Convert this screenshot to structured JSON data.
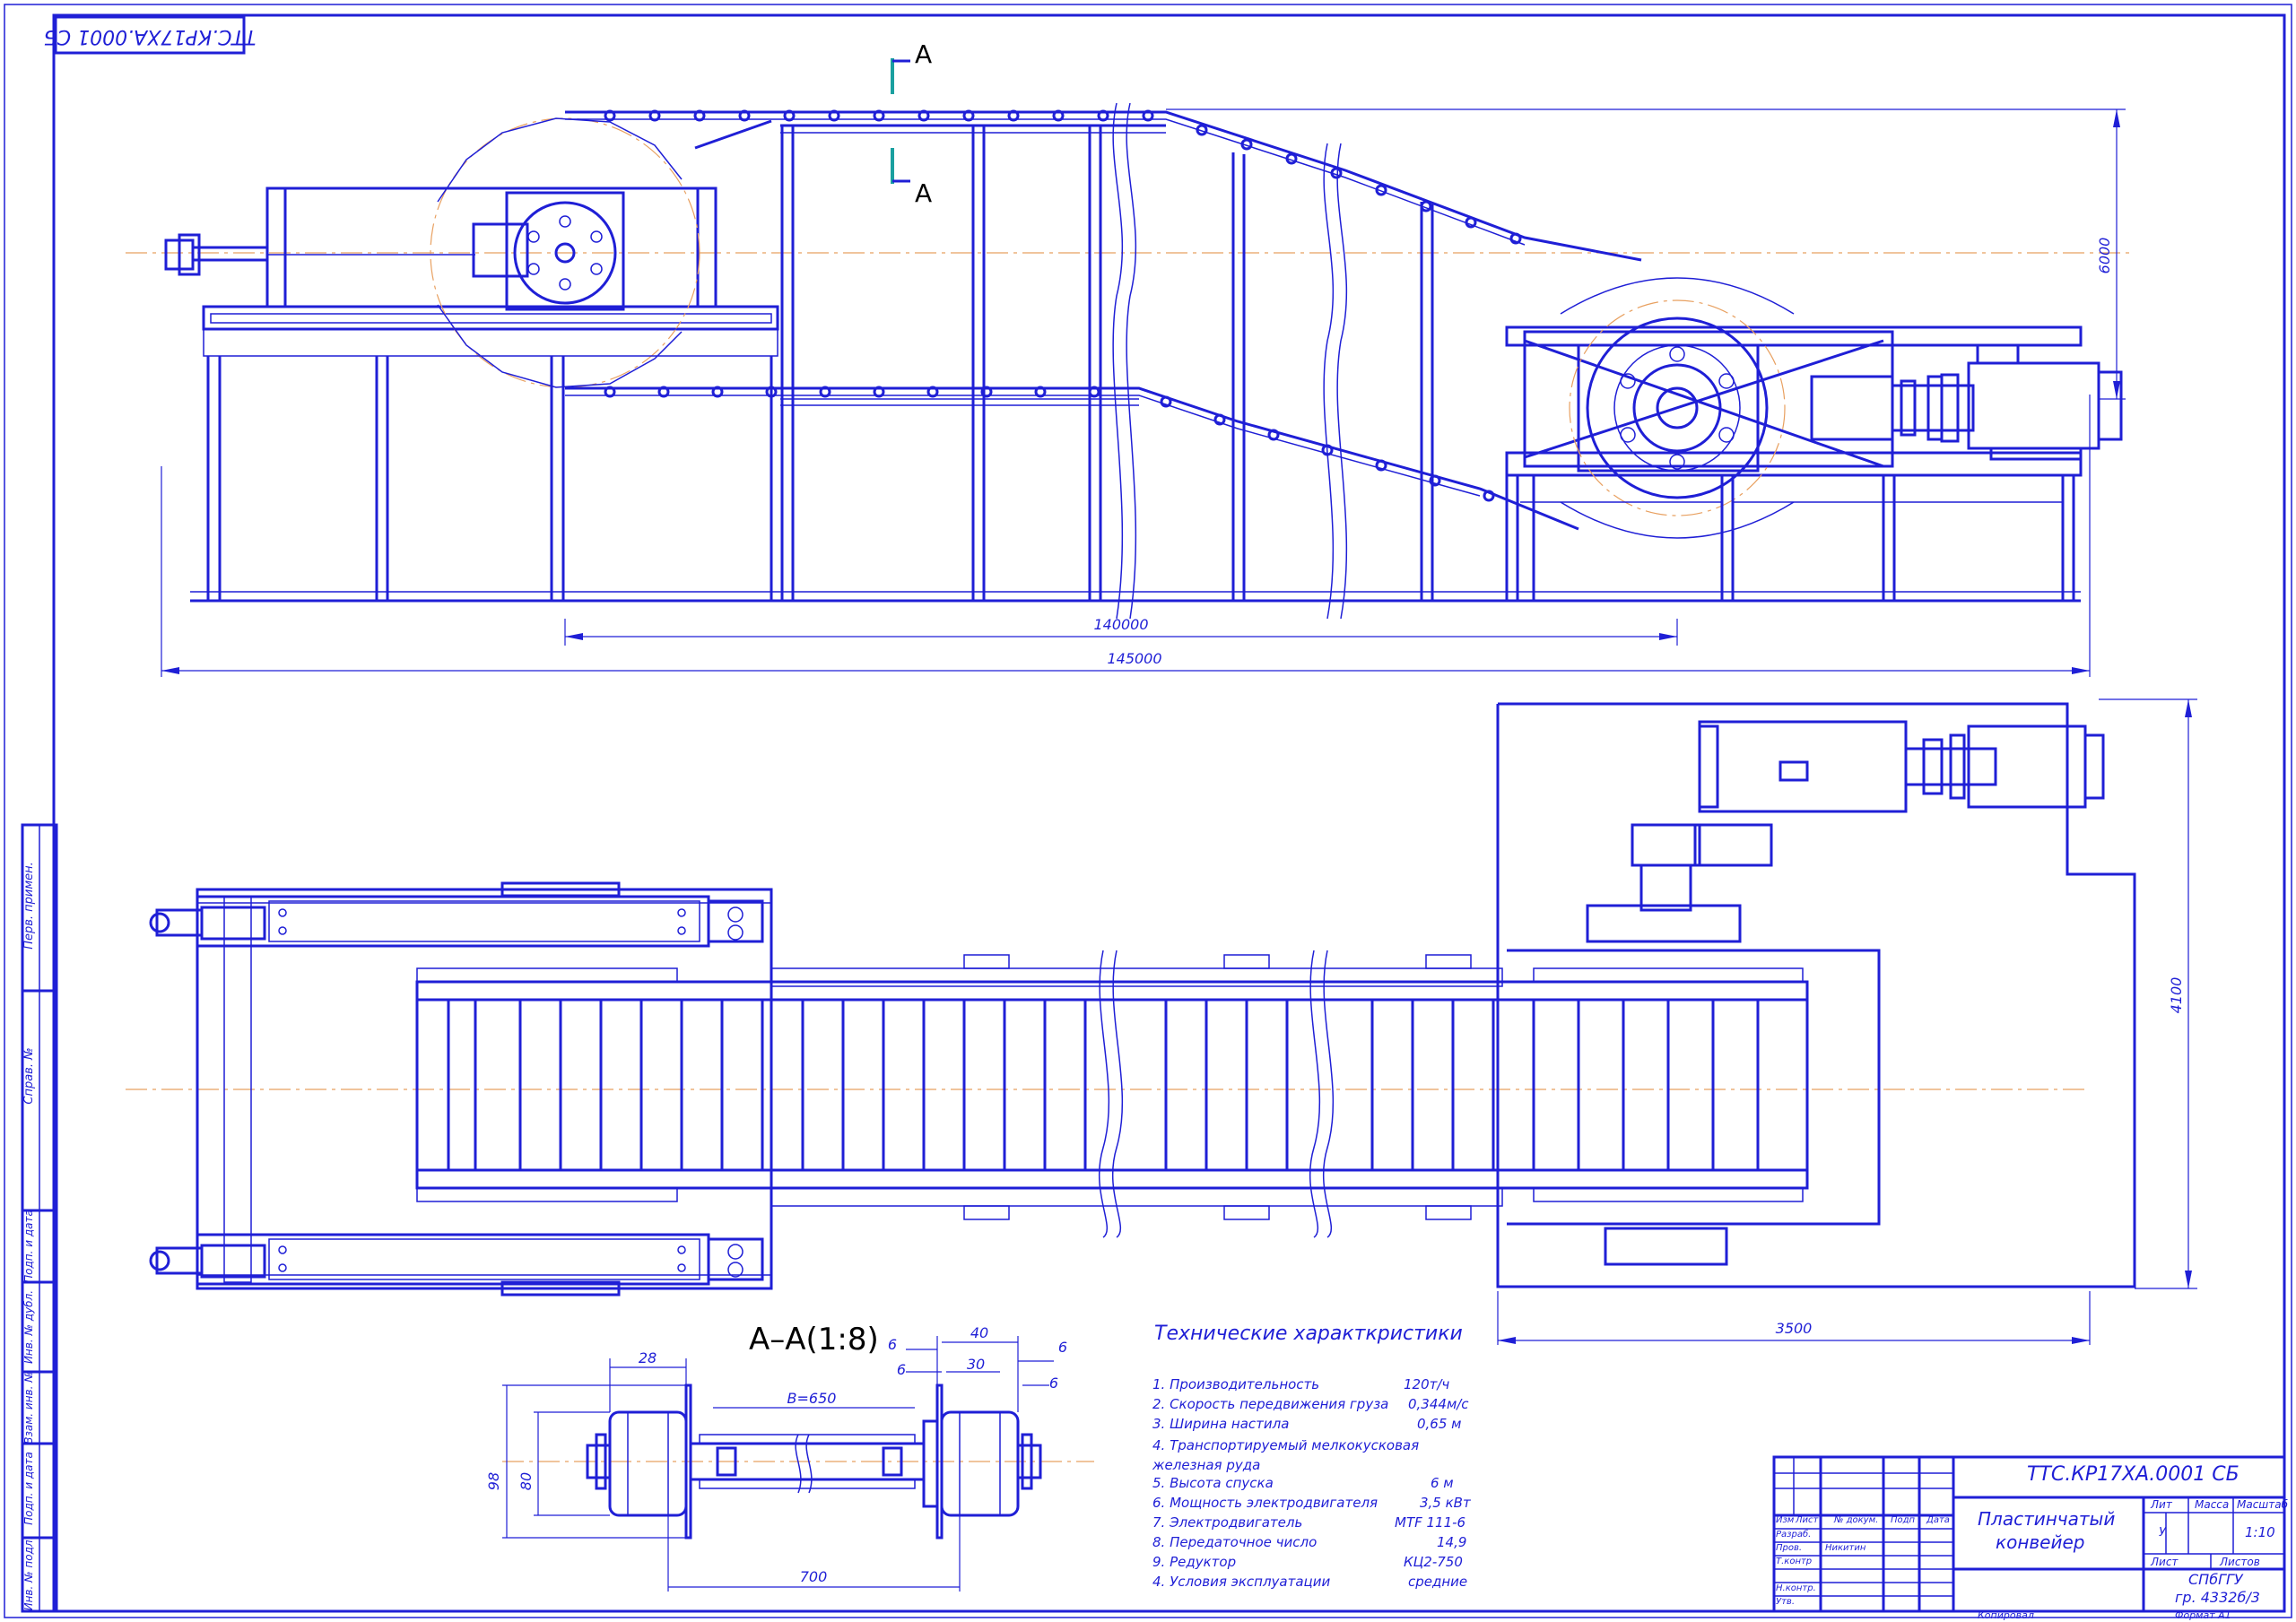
{
  "stamp_code_rotated": "ТТС.КР17ХА.0001 СБ",
  "section": {
    "marker_letter": "A",
    "title": "А–А(1:8)"
  },
  "dimensions": {
    "top_height": "6000",
    "len_140": "140000",
    "len_145": "145000",
    "plan_height": "4100",
    "plan_width": "3500",
    "sec_28": "28",
    "sec_B": "B=650",
    "sec_98": "98",
    "sec_80": "80",
    "sec_700": "700",
    "sec_40": "40",
    "sec_30": "30",
    "sec_6a": "6",
    "sec_6b": "6",
    "sec_6c": "6",
    "sec_6d": "6"
  },
  "specs": {
    "heading": "Технические характкристики",
    "items": [
      {
        "label": "1. Производительность",
        "value": "120т/ч"
      },
      {
        "label": "2. Скорость передвижения груза",
        "value": "0,344м/с"
      },
      {
        "label": "3. Ширина настила",
        "value": "0,65 м"
      },
      {
        "label": "4. Транспортируемый мелкокусковая железная руда",
        "value": ""
      },
      {
        "label": "5. Высота спуска",
        "value": "6 м"
      },
      {
        "label": "6. Мощность электродвигателя",
        "value": "3,5 кВт"
      },
      {
        "label": "7. Электродвигатель",
        "value": "MTF 111-6"
      },
      {
        "label": "8. Передаточное число",
        "value": "14,9"
      },
      {
        "label": "9. Редуктор",
        "value": "КЦ2-750"
      },
      {
        "label": "4. Условия эксплуатации",
        "value": "средние"
      }
    ]
  },
  "title_block": {
    "doc_code": "ТТС.КР17ХА.0001 СБ",
    "name_line1": "Пластинчатый",
    "name_line2": "конвейер",
    "col_lit": "Лит",
    "col_mass": "Масса",
    "col_scale": "Масштаб",
    "lit_value": "У",
    "scale_value": "1:10",
    "sheet": "Лист",
    "sheets": "Листов",
    "org": "СПбГГУ",
    "group": "гр. 4332б/3",
    "hdr_izm": "Изм",
    "hdr_list": "Лист",
    "hdr_ndoc": "№ докум.",
    "hdr_podp": "Подп",
    "hdr_data": "Дата",
    "razrab": "Разраб.",
    "prov": "Пров.",
    "tkontr": "Т.контр",
    "nkontr": "Н.контр.",
    "utv": "Утв.",
    "checker": "Никитин",
    "copied": "Копировал",
    "format": "Формат А1"
  },
  "side_strip": [
    "Перв. примен.",
    "Справ. №",
    "Подп. и дата",
    "Инв. № дубл.",
    "Взам. инв. №",
    "Подп. и дата",
    "Инв. № подл."
  ]
}
